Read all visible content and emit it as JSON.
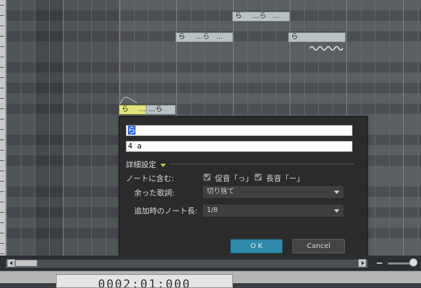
{
  "notes": [
    {
      "lyric": "ら",
      "tail": "…ら",
      "tail2": "…"
    },
    {
      "lyric": "ら",
      "tail": "…ら",
      "tail2": "…"
    },
    {
      "lyric": "ら",
      "tail": "…ら",
      "tail2": "…"
    },
    {
      "lyric": "ら",
      "tail": "…ら",
      "tail2": "…"
    }
  ],
  "dialog": {
    "lyric_value": "ら",
    "phoneme_value": "4 a",
    "advanced_label": "詳細設定",
    "include_label": "ノートに含む:",
    "sokuon_label": "促音「っ」",
    "chouon_label": "長音「ー」",
    "leftover_label": "余った歌詞:",
    "leftover_value": "切り捨て",
    "length_label": "追加時のノート長:",
    "length_value": "1/8",
    "ok_label": "O K",
    "cancel_label": "Cancel"
  },
  "status": {
    "time": "0002:01:000"
  },
  "colors": {
    "accent": "#2f89a9",
    "selected_note": "#e3e47a",
    "playhead": "#d63a3a"
  }
}
